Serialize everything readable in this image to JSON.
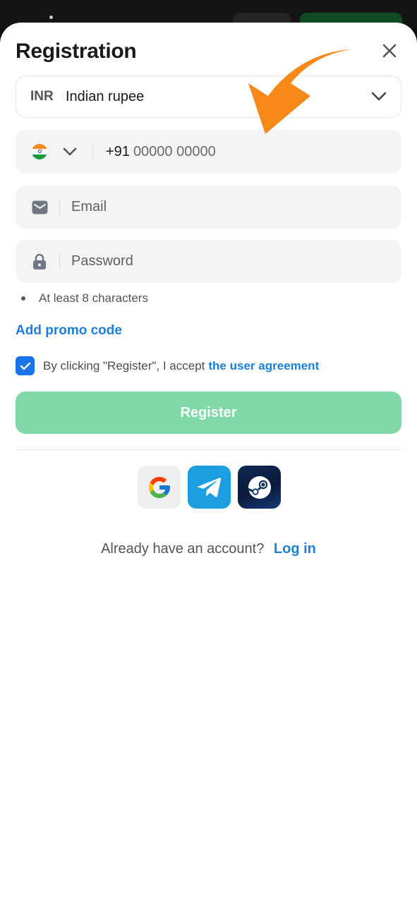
{
  "modal": {
    "title": "Registration"
  },
  "currency": {
    "code": "INR",
    "name": "Indian rupee"
  },
  "phone": {
    "prefix": "+91",
    "placeholder": "00000 00000"
  },
  "email": {
    "placeholder": "Email"
  },
  "password": {
    "placeholder": "Password",
    "requirement": "At least 8 characters"
  },
  "promo": {
    "label": "Add promo code"
  },
  "agreement": {
    "text": "By clicking \"Register\", I accept",
    "link": "the user agreement"
  },
  "register": {
    "label": "Register"
  },
  "social": {
    "providers": [
      "google-icon",
      "telegram-icon",
      "steam-icon"
    ]
  },
  "login": {
    "question": "Already have an account?",
    "link": "Log in"
  },
  "colors": {
    "accent": "#1e7fd8",
    "register_button": "#80d9a6",
    "checkbox": "#1a73e8",
    "annotation_arrow": "#f7891a"
  }
}
